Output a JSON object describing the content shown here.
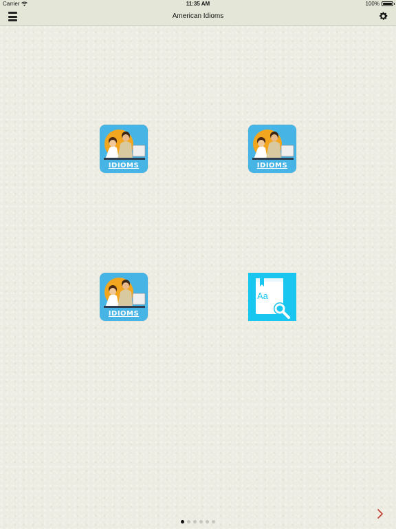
{
  "status_bar": {
    "carrier": "Carrier",
    "time": "11:35 AM",
    "battery": "100%",
    "battery_level": 1.0
  },
  "nav_bar": {
    "title": "American Idioms",
    "menu_icon": "hamburger-menu-icon",
    "settings_icon": "gear-icon"
  },
  "apps": [
    {
      "label": "IDIOMS",
      "icon": "idioms-app-icon"
    },
    {
      "label": "IDIOMS",
      "icon": "idioms-app-icon"
    },
    {
      "label": "IDIOMS",
      "icon": "idioms-app-icon"
    },
    {
      "icon": "dictionary-search-icon",
      "glyph_text": "Aa"
    }
  ],
  "pagination": {
    "pages": 6,
    "current": 1
  },
  "next_icon": "chevron-right-icon",
  "colors": {
    "tile_blue": "#46b4e5",
    "dictionary_blue": "#19c6f0",
    "next_arrow": "#c0392b"
  }
}
